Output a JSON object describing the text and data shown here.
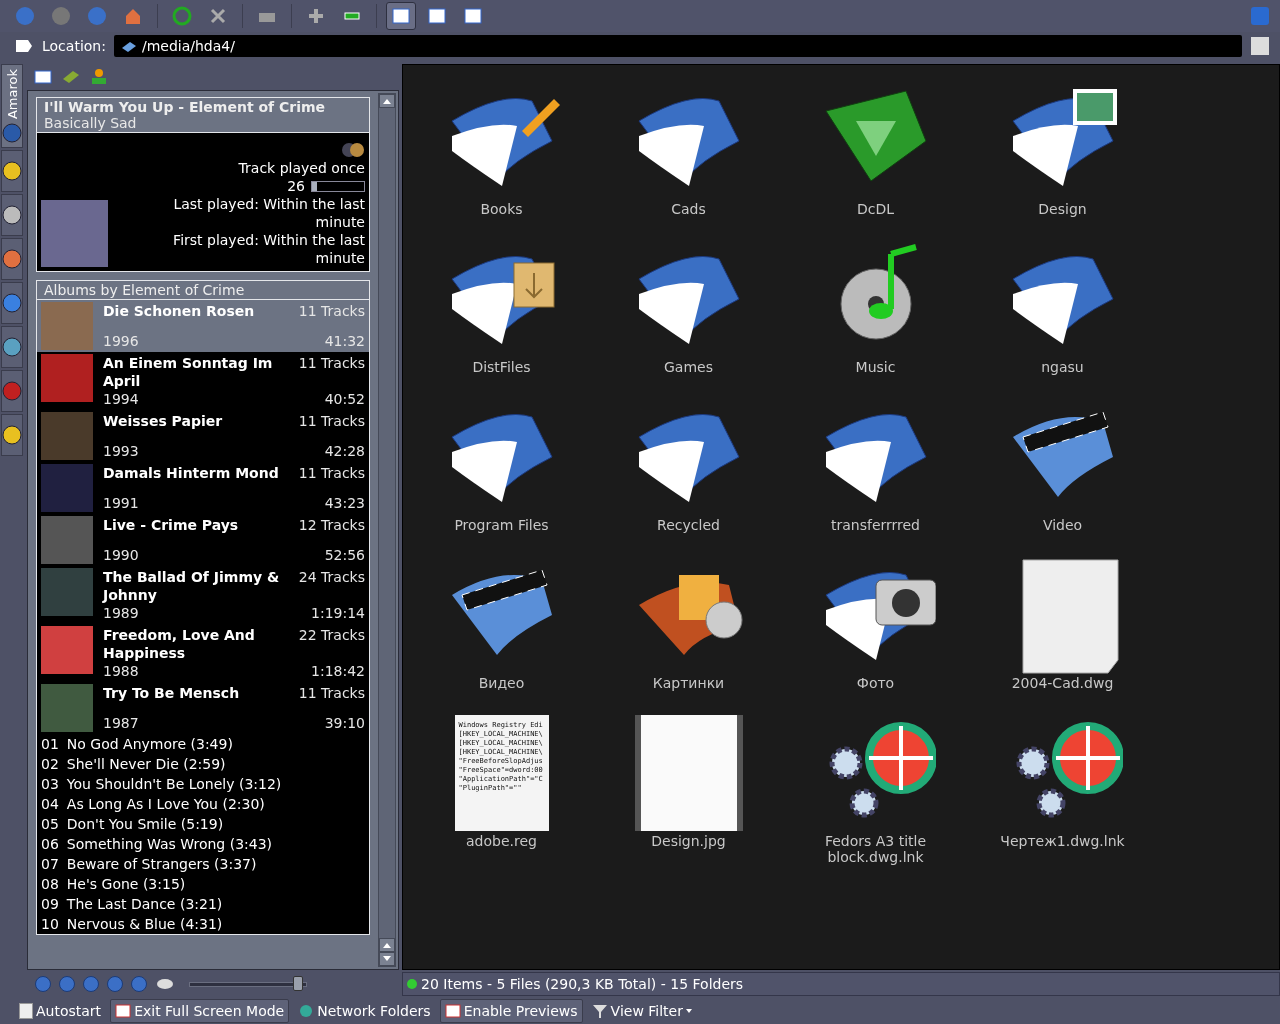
{
  "toolbar": {
    "view_modes": [
      {
        "selected": true
      },
      {
        "selected": false
      },
      {
        "selected": false
      }
    ]
  },
  "location": {
    "label": "Location:",
    "value": "/media/hda4/"
  },
  "sidebar_tabs": [
    {
      "label": "Amarok",
      "selected": true
    },
    {
      "selected": false
    },
    {
      "selected": false
    },
    {
      "selected": false
    },
    {
      "selected": false
    },
    {
      "selected": false
    },
    {
      "selected": false
    },
    {
      "selected": false
    }
  ],
  "now_playing": {
    "title": "I'll Warm You Up - Element of Crime",
    "subtitle": "Basically Sad",
    "play_count": "Track played once",
    "score": "26",
    "score_bar": {
      "level": 0.1
    },
    "last_played": "Last played: Within the last minute",
    "first_played": "First played: Within the last minute"
  },
  "albums": {
    "heading": "Albums by Element of Crime",
    "items": [
      {
        "title": "Die Schonen Rosen",
        "year": "1996",
        "tracks": "11 Tracks",
        "length": "41:32",
        "selected": true
      },
      {
        "title": "An Einem Sonntag Im April",
        "year": "1994",
        "tracks": "11 Tracks",
        "length": "40:52",
        "selected": false
      },
      {
        "title": "Weisses Papier",
        "year": "1993",
        "tracks": "11 Tracks",
        "length": "42:28",
        "selected": false
      },
      {
        "title": "Damals Hinterm Mond",
        "year": "1991",
        "tracks": "11 Tracks",
        "length": "43:23",
        "selected": false
      },
      {
        "title": "Live - Crime Pays",
        "year": "1990",
        "tracks": "12 Tracks",
        "length": "52:56",
        "selected": false
      },
      {
        "title": "The Ballad Of Jimmy & Johnny",
        "year": "1989",
        "tracks": "24 Tracks",
        "length": "1:19:14",
        "selected": false
      },
      {
        "title": "Freedom, Love And Happiness",
        "year": "1988",
        "tracks": "22 Tracks",
        "length": "1:18:42",
        "selected": false
      },
      {
        "title": "Try To Be Mensch",
        "year": "1987",
        "tracks": "11 Tracks",
        "length": "39:10",
        "selected": false
      }
    ]
  },
  "tracks": [
    {
      "number": "01",
      "title": "No God Anymore (3:49)"
    },
    {
      "number": "02",
      "title": "She'll Never Die (2:59)"
    },
    {
      "number": "03",
      "title": "You Shouldn't Be Lonely (3:12)"
    },
    {
      "number": "04",
      "title": "As Long As I Love You (2:30)"
    },
    {
      "number": "05",
      "title": "Don't You Smile (5:19)"
    },
    {
      "number": "06",
      "title": "Something Was Wrong (3:43)"
    },
    {
      "number": "07",
      "title": "Beware of Strangers (3:37)"
    },
    {
      "number": "08",
      "title": "He's Gone (3:15)"
    },
    {
      "number": "09",
      "title": "The Last Dance (3:21)"
    },
    {
      "number": "10",
      "title": "Nervous & Blue (4:31)"
    }
  ],
  "player": {
    "volume": {
      "level": 0.92
    }
  },
  "files": [
    {
      "name": "Books",
      "kind": "folder-edit"
    },
    {
      "name": "Cads",
      "kind": "folder"
    },
    {
      "name": "DcDL",
      "kind": "folder-green"
    },
    {
      "name": "Design",
      "kind": "folder-image"
    },
    {
      "name": "DistFiles",
      "kind": "folder-box"
    },
    {
      "name": "Games",
      "kind": "folder"
    },
    {
      "name": "Music",
      "kind": "music"
    },
    {
      "name": "ngasu",
      "kind": "folder"
    },
    {
      "name": "Program Files",
      "kind": "folder"
    },
    {
      "name": "Recycled",
      "kind": "folder"
    },
    {
      "name": "transferrrred",
      "kind": "folder"
    },
    {
      "name": "Video",
      "kind": "video"
    },
    {
      "name": "Видео",
      "kind": "video"
    },
    {
      "name": "Картинки",
      "kind": "pictures"
    },
    {
      "name": "Фото",
      "kind": "camera"
    },
    {
      "name": "2004-Cad.dwg",
      "kind": "blank"
    },
    {
      "name": "adobe.reg",
      "kind": "text",
      "preview_lines": [
        "Windows Registry Edi",
        "[HKEY_LOCAL_MACHINE\\",
        "[HKEY_LOCAL_MACHINE\\",
        "[HKEY_LOCAL_MACHINE\\",
        "\"FreeBeforeSlopAdjus",
        "\"FreeSpace\"=dword:00",
        "\"ApplicationPath\"=\"C",
        "\"PluginPath\"=\"\""
      ]
    },
    {
      "name": "Design.jpg",
      "kind": "image"
    },
    {
      "name": "Fedors A3 title block.dwg.lnk",
      "kind": "gears"
    },
    {
      "name": "Чертеж1.dwg.lnk",
      "kind": "gears"
    }
  ],
  "status": "20 Items - 5 Files (290,3 KB Total) - 15 Folders",
  "bottom_bar": [
    {
      "kind": "checkbox",
      "label": "Autostart",
      "checked": false
    },
    {
      "kind": "button",
      "label": "Exit Full Screen Mode"
    },
    {
      "kind": "link",
      "label": "Network Folders"
    },
    {
      "kind": "button",
      "label": "Enable Previews"
    },
    {
      "kind": "menu",
      "label": "View Filter"
    }
  ]
}
